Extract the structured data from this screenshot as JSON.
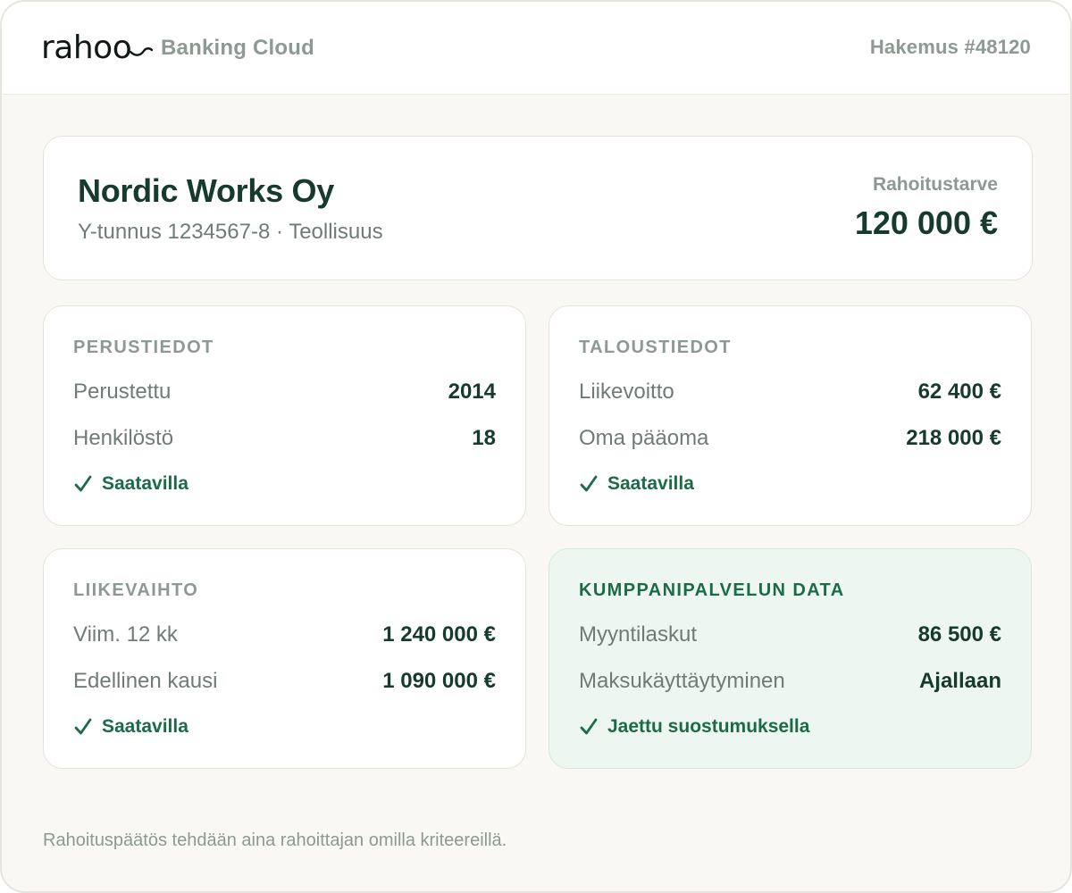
{
  "header": {
    "logo_text": "rahoo",
    "product_name": "Banking Cloud",
    "application_id": "Hakemus #48120"
  },
  "company": {
    "name": "Nordic Works Oy",
    "meta": "Y-tunnus 1234567-8 · Teollisuus",
    "need_label": "Rahoitustarve",
    "need_value": "120 000 €"
  },
  "cards": [
    {
      "title": "PERUSTIEDOT",
      "rows": [
        {
          "label": "Perustettu",
          "value": "2014"
        },
        {
          "label": "Henkilöstö",
          "value": "18"
        }
      ],
      "status": "Saatavilla"
    },
    {
      "title": "TALOUSTIEDOT",
      "rows": [
        {
          "label": "Liikevoitto",
          "value": "62 400 €"
        },
        {
          "label": "Oma pääoma",
          "value": "218 000 €"
        }
      ],
      "status": "Saatavilla"
    },
    {
      "title": "LIIKEVAIHTO",
      "rows": [
        {
          "label": "Viim. 12 kk",
          "value": "1 240 000 €"
        },
        {
          "label": "Edellinen kausi",
          "value": "1 090 000 €"
        }
      ],
      "status": "Saatavilla"
    },
    {
      "title": "KUMPPANIPALVELUN DATA",
      "rows": [
        {
          "label": "Myyntilaskut",
          "value": "86 500 €"
        },
        {
          "label": "Maksukäyttäytyminen",
          "value": "Ajallaan"
        }
      ],
      "status": "Jaettu suostumuksella"
    }
  ],
  "footer": {
    "note": "Rahoituspäätös tehdään aina rahoittajan omilla kriteereillä."
  },
  "colors": {
    "brand_dark": "#173a2e",
    "accent_green": "#1c6b47",
    "muted_text": "#8d9993",
    "partner_card_bg": "#eef6f1"
  },
  "icons": {
    "status": "check-icon",
    "logo_mark": "swash-icon"
  }
}
